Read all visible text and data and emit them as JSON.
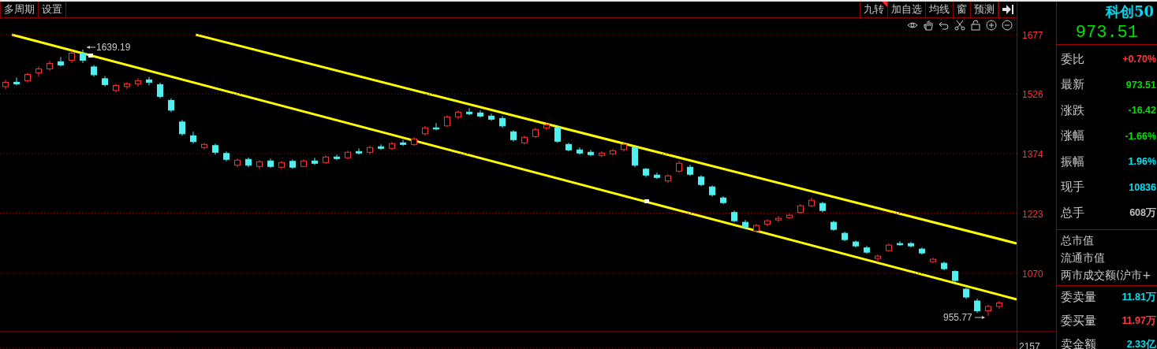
{
  "toolbar": {
    "left_tabs": [
      {
        "label": "多周期"
      },
      {
        "label": "设置"
      }
    ],
    "right_buttons": [
      {
        "label": "九转",
        "flagged": true
      },
      {
        "label": "加自选",
        "flagged": false
      },
      {
        "label": "均线",
        "flagged": false
      },
      {
        "label": "窗",
        "flagged": false
      },
      {
        "label": "预测",
        "flagged": false
      }
    ]
  },
  "chart": {
    "lower_tick": "2157",
    "high_label": "1639.19",
    "low_label": "955.77",
    "chart_data": {
      "type": "candlestick",
      "ylim": [
        922,
        1719
      ],
      "yticks": [
        1677,
        1526,
        1374,
        1223,
        1070
      ],
      "grid": true,
      "ohlc": [
        [
          1545,
          1562,
          1538,
          1556
        ],
        [
          1556,
          1568,
          1548,
          1552
        ],
        [
          1560,
          1580,
          1555,
          1576
        ],
        [
          1580,
          1596,
          1570,
          1590
        ],
        [
          1590,
          1610,
          1585,
          1604
        ],
        [
          1608,
          1620,
          1596,
          1600
        ],
        [
          1612,
          1636,
          1605,
          1630
        ],
        [
          1630,
          1639,
          1605,
          1612
        ],
        [
          1595,
          1600,
          1570,
          1575
        ],
        [
          1565,
          1572,
          1545,
          1550
        ],
        [
          1535,
          1552,
          1530,
          1548
        ],
        [
          1545,
          1556,
          1538,
          1552
        ],
        [
          1552,
          1566,
          1545,
          1560
        ],
        [
          1562,
          1570,
          1548,
          1556
        ],
        [
          1550,
          1555,
          1515,
          1520
        ],
        [
          1510,
          1515,
          1480,
          1485
        ],
        [
          1455,
          1460,
          1420,
          1425
        ],
        [
          1420,
          1430,
          1400,
          1405
        ],
        [
          1390,
          1402,
          1385,
          1398
        ],
        [
          1395,
          1400,
          1372,
          1378
        ],
        [
          1375,
          1380,
          1355,
          1360
        ],
        [
          1345,
          1362,
          1340,
          1358
        ],
        [
          1360,
          1365,
          1340,
          1345
        ],
        [
          1342,
          1358,
          1336,
          1354
        ],
        [
          1356,
          1362,
          1338,
          1342
        ],
        [
          1340,
          1356,
          1335,
          1352
        ],
        [
          1355,
          1360,
          1336,
          1340
        ],
        [
          1342,
          1360,
          1340,
          1356
        ],
        [
          1356,
          1364,
          1346,
          1350
        ],
        [
          1352,
          1370,
          1348,
          1366
        ],
        [
          1366,
          1372,
          1358,
          1362
        ],
        [
          1364,
          1382,
          1360,
          1378
        ],
        [
          1380,
          1388,
          1372,
          1376
        ],
        [
          1378,
          1394,
          1372,
          1390
        ],
        [
          1392,
          1398,
          1384,
          1388
        ],
        [
          1388,
          1404,
          1384,
          1400
        ],
        [
          1402,
          1410,
          1394,
          1398
        ],
        [
          1398,
          1416,
          1394,
          1412
        ],
        [
          1425,
          1445,
          1420,
          1440
        ],
        [
          1440,
          1452,
          1434,
          1438
        ],
        [
          1445,
          1472,
          1442,
          1468
        ],
        [
          1468,
          1484,
          1462,
          1480
        ],
        [
          1480,
          1490,
          1472,
          1476
        ],
        [
          1478,
          1484,
          1466,
          1470
        ],
        [
          1470,
          1476,
          1458,
          1462
        ],
        [
          1464,
          1470,
          1440,
          1445
        ],
        [
          1430,
          1434,
          1405,
          1410
        ],
        [
          1402,
          1420,
          1398,
          1416
        ],
        [
          1418,
          1440,
          1414,
          1436
        ],
        [
          1440,
          1452,
          1434,
          1448
        ],
        [
          1440,
          1446,
          1402,
          1406
        ],
        [
          1398,
          1402,
          1380,
          1384
        ],
        [
          1384,
          1390,
          1372,
          1376
        ],
        [
          1378,
          1384,
          1368,
          1372
        ],
        [
          1370,
          1380,
          1366,
          1376
        ],
        [
          1374,
          1386,
          1370,
          1382
        ],
        [
          1385,
          1402,
          1380,
          1398
        ],
        [
          1390,
          1394,
          1340,
          1345
        ],
        [
          1335,
          1338,
          1315,
          1320
        ],
        [
          1320,
          1326,
          1310,
          1314
        ],
        [
          1305,
          1322,
          1300,
          1318
        ],
        [
          1330,
          1356,
          1326,
          1350
        ],
        [
          1340,
          1346,
          1318,
          1322
        ],
        [
          1315,
          1320,
          1292,
          1296
        ],
        [
          1290,
          1294,
          1265,
          1270
        ],
        [
          1262,
          1266,
          1246,
          1250
        ],
        [
          1225,
          1230,
          1200,
          1204
        ],
        [
          1200,
          1206,
          1184,
          1188
        ],
        [
          1178,
          1196,
          1174,
          1192
        ],
        [
          1195,
          1208,
          1190,
          1204
        ],
        [
          1206,
          1216,
          1200,
          1210
        ],
        [
          1212,
          1222,
          1208,
          1218
        ],
        [
          1225,
          1246,
          1222,
          1242
        ],
        [
          1242,
          1262,
          1238,
          1256
        ],
        [
          1248,
          1252,
          1225,
          1230
        ],
        [
          1200,
          1204,
          1178,
          1182
        ],
        [
          1172,
          1176,
          1152,
          1156
        ],
        [
          1150,
          1154,
          1136,
          1140
        ],
        [
          1135,
          1140,
          1120,
          1124
        ],
        [
          1108,
          1118,
          1098,
          1114
        ],
        [
          1128,
          1146,
          1126,
          1142
        ],
        [
          1146,
          1152,
          1140,
          1144
        ],
        [
          1146,
          1150,
          1136,
          1140
        ],
        [
          1132,
          1136,
          1118,
          1122
        ],
        [
          1100,
          1110,
          1096,
          1106
        ],
        [
          1096,
          1100,
          1078,
          1082
        ],
        [
          1075,
          1078,
          1048,
          1052
        ],
        [
          1030,
          1034,
          1005,
          1010
        ],
        [
          1000,
          1006,
          970,
          975
        ],
        [
          975,
          990,
          962,
          986
        ],
        [
          986,
          1000,
          980,
          995
        ]
      ]
    }
  },
  "panel": {
    "name": "科创50",
    "price": "973.51",
    "quote_rows": [
      {
        "label": "委比",
        "value": "+0.70%",
        "color": "#ff3b3b"
      },
      {
        "label": "最新",
        "value": "973.51",
        "color": "#00e000"
      },
      {
        "label": "涨跌",
        "value": "-16.42",
        "color": "#00e000"
      },
      {
        "label": "涨幅",
        "value": "-1.66%",
        "color": "#00e000"
      },
      {
        "label": "振幅",
        "value": "1.96%",
        "color": "#00e0f0"
      },
      {
        "label": "现手",
        "value": "10836",
        "color": "#00e0f0"
      },
      {
        "label": "总手",
        "value": "608万",
        "color": "#c0c0c0"
      }
    ],
    "info_rows": [
      {
        "label": "总市值"
      },
      {
        "label": "流通市值"
      },
      {
        "label": "两市成交额(沪市+"
      }
    ],
    "order_rows": [
      {
        "label": "委卖量",
        "value": "11.81万",
        "color": "#00e0f0"
      },
      {
        "label": "委买量",
        "value": "11.97万",
        "color": "#ff3b3b"
      },
      {
        "label": "卖金额",
        "value": "2.33亿",
        "color": "#00e0f0"
      }
    ]
  }
}
